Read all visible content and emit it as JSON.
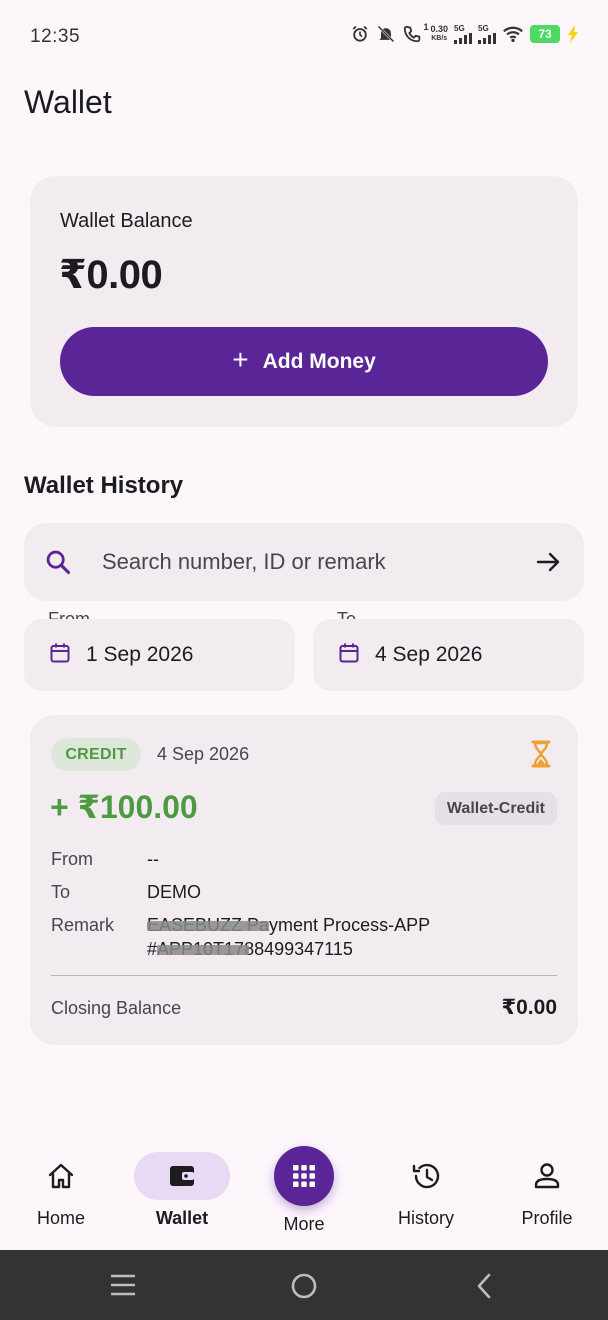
{
  "status_bar": {
    "time": "12:35",
    "net_speed_value": "0.30",
    "net_speed_unit": "KB/s",
    "net_type_1": "5G",
    "net_type_2": "5G",
    "sim_label": "1",
    "battery": "73"
  },
  "page": {
    "title": "Wallet"
  },
  "balance_card": {
    "label": "Wallet Balance",
    "amount": "₹0.00",
    "add_money_label": "Add Money"
  },
  "history": {
    "title": "Wallet History",
    "search_placeholder": "Search number, ID or remark",
    "from_label": "From",
    "from_date": "1 Sep 2026",
    "to_label": "To",
    "to_date": "4 Sep 2026"
  },
  "transactions": [
    {
      "type_chip": "CREDIT",
      "date": "4 Sep 2026",
      "amount": "+ ₹100.00",
      "category": "Wallet-Credit",
      "from_label": "From",
      "from_value": "--",
      "to_label": "To",
      "to_value": "DEMO",
      "remark_label": "Remark",
      "remark_line1": "EASEBUZZ Payment Process-APP",
      "remark_line2": "#APP10T1788499347115",
      "closing_label": "Closing Balance",
      "closing_value": "₹0.00"
    }
  ],
  "bottom_nav": {
    "items": [
      {
        "label": "Home"
      },
      {
        "label": "Wallet"
      },
      {
        "label": "More"
      },
      {
        "label": "History"
      },
      {
        "label": "Profile"
      }
    ]
  },
  "colors": {
    "primary": "#5A2596",
    "credit_green": "#4E9A43",
    "pending_orange": "#F0A030",
    "background": "#FDF7FC",
    "card": "#F2ECF1"
  }
}
